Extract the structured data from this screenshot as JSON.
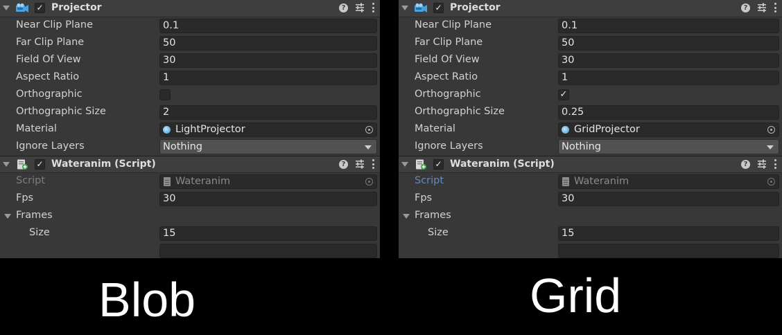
{
  "panels": {
    "left": {
      "projector": {
        "title": "Projector",
        "enabled_mark": "✓",
        "near_clip_plane": {
          "label": "Near Clip Plane",
          "value": "0.1"
        },
        "far_clip_plane": {
          "label": "Far Clip Plane",
          "value": "50"
        },
        "field_of_view": {
          "label": "Field Of View",
          "value": "30"
        },
        "aspect_ratio": {
          "label": "Aspect Ratio",
          "value": "1"
        },
        "orthographic": {
          "label": "Orthographic",
          "mark": ""
        },
        "orthographic_size": {
          "label": "Orthographic Size",
          "value": "2"
        },
        "material": {
          "label": "Material",
          "value": "LightProjector"
        },
        "ignore_layers": {
          "label": "Ignore Layers",
          "value": "Nothing"
        }
      },
      "wateranim": {
        "title": "Wateranim (Script)",
        "enabled_mark": "✓",
        "script": {
          "label": "Script",
          "value": "Wateranim"
        },
        "fps": {
          "label": "Fps",
          "value": "30"
        },
        "frames": {
          "label": "Frames"
        },
        "size": {
          "label": "Size",
          "value": "15"
        }
      }
    },
    "right": {
      "projector": {
        "title": "Projector",
        "enabled_mark": "✓",
        "near_clip_plane": {
          "label": "Near Clip Plane",
          "value": "0.1"
        },
        "far_clip_plane": {
          "label": "Far Clip Plane",
          "value": "50"
        },
        "field_of_view": {
          "label": "Field Of View",
          "value": "30"
        },
        "aspect_ratio": {
          "label": "Aspect Ratio",
          "value": "1"
        },
        "orthographic": {
          "label": "Orthographic",
          "mark": "✓"
        },
        "orthographic_size": {
          "label": "Orthographic Size",
          "value": "0.25"
        },
        "material": {
          "label": "Material",
          "value": "GridProjector"
        },
        "ignore_layers": {
          "label": "Ignore Layers",
          "value": "Nothing"
        }
      },
      "wateranim": {
        "title": "Wateranim (Script)",
        "enabled_mark": "✓",
        "script": {
          "label": "Script",
          "value": "Wateranim"
        },
        "fps": {
          "label": "Fps",
          "value": "30"
        },
        "frames": {
          "label": "Frames"
        },
        "size": {
          "label": "Size",
          "value": "15"
        }
      }
    }
  },
  "captions": {
    "left": "Blob",
    "right": "Grid"
  },
  "icons": [
    "projector-icon",
    "script-icon",
    "help-icon",
    "preset-icon",
    "menu-icon",
    "object-picker-icon",
    "dropdown-arrow-icon",
    "foldout-arrow-icon"
  ],
  "colors": {
    "background": "#000000",
    "panel": "#383838",
    "header": "#3e3e3e",
    "field": "#2a2a2a",
    "selected_label": "#5f8bc6"
  }
}
